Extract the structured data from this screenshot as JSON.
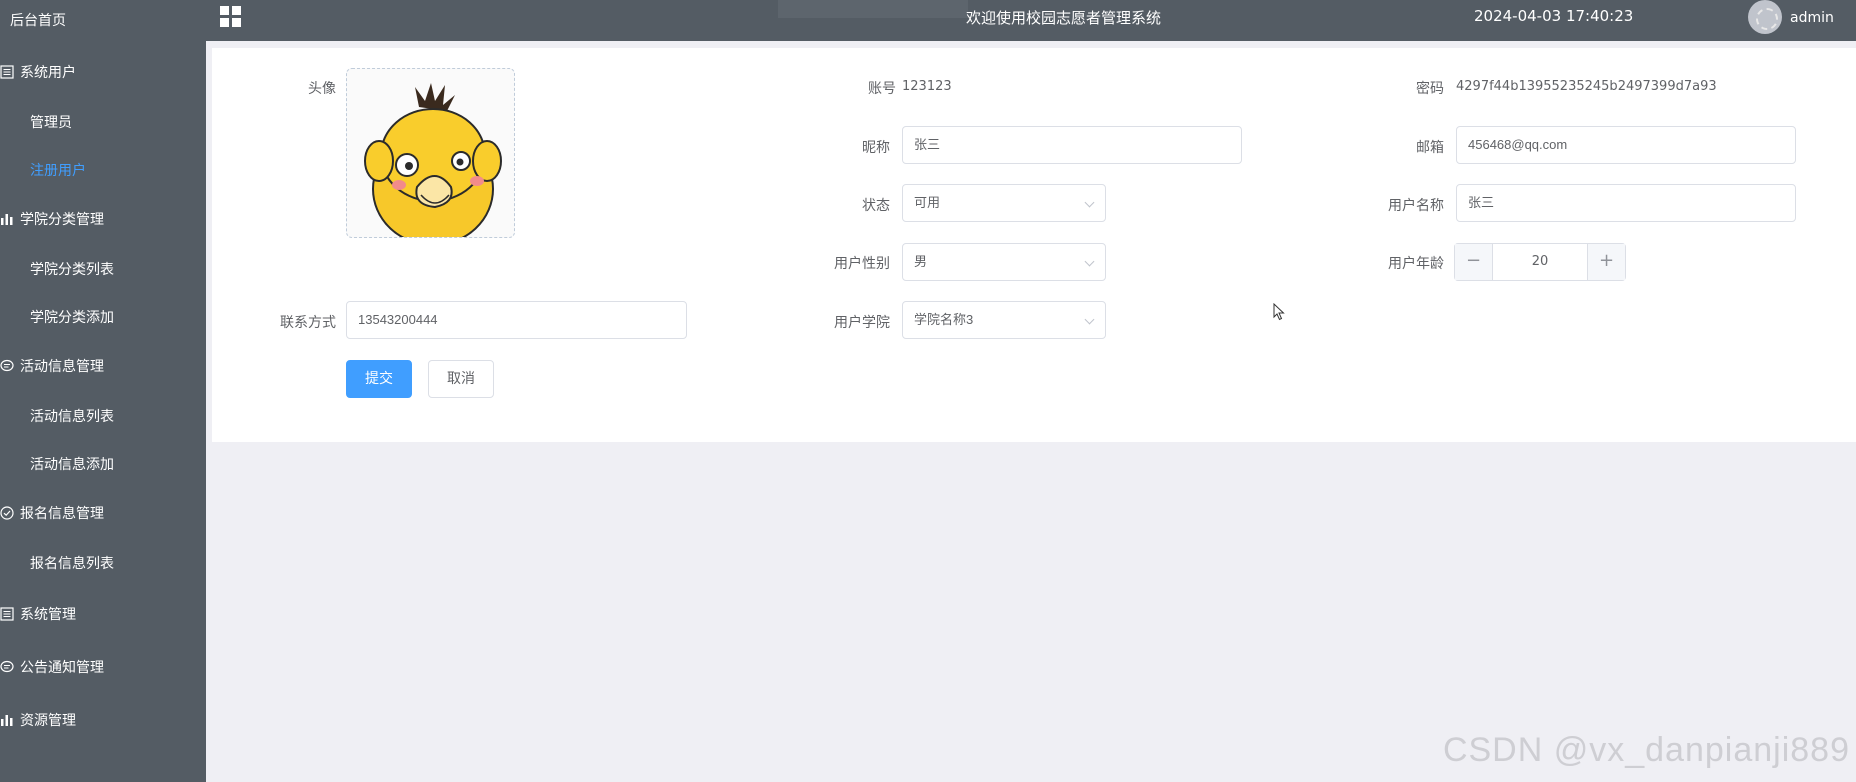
{
  "sidebar": {
    "home": "后台首页",
    "items": [
      {
        "label": "系统用户",
        "icon": "list-icon"
      },
      {
        "label": "管理员"
      },
      {
        "label": "注册用户",
        "active": true
      },
      {
        "label": "学院分类管理",
        "icon": "bar-chart-icon"
      },
      {
        "label": "学院分类列表"
      },
      {
        "label": "学院分类添加"
      },
      {
        "label": "活动信息管理",
        "icon": "chat-icon"
      },
      {
        "label": "活动信息列表"
      },
      {
        "label": "活动信息添加"
      },
      {
        "label": "报名信息管理",
        "icon": "check-circle-icon"
      },
      {
        "label": "报名信息列表"
      },
      {
        "label": "系统管理",
        "icon": "list-icon"
      },
      {
        "label": "公告通知管理",
        "icon": "chat-icon"
      },
      {
        "label": "资源管理",
        "icon": "bar-chart-icon"
      }
    ]
  },
  "header": {
    "title": "欢迎使用校园志愿者管理系统",
    "datetime": "2024-04-03 17:40:23",
    "user": "admin"
  },
  "form": {
    "avatar_label": "头像",
    "account_label": "账号",
    "account_value": "123123",
    "password_label": "密码",
    "password_value": "4297f44b13955235245b2497399d7a93",
    "nickname_label": "昵称",
    "nickname_value": "张三",
    "email_label": "邮箱",
    "email_value": "456468@qq.com",
    "status_label": "状态",
    "status_value": "可用",
    "username_label": "用户名称",
    "username_value": "张三",
    "gender_label": "用户性别",
    "gender_value": "男",
    "age_label": "用户年龄",
    "age_value": "20",
    "phone_label": "联系方式",
    "phone_value": "13543200444",
    "college_label": "用户学院",
    "college_value": "学院名称3",
    "submit_label": "提交",
    "cancel_label": "取消"
  },
  "watermark": "CSDN @vx_danpianji889",
  "colors": {
    "sidebar_bg": "#545c64",
    "accent": "#409eff",
    "page_bg": "#efeff4"
  }
}
